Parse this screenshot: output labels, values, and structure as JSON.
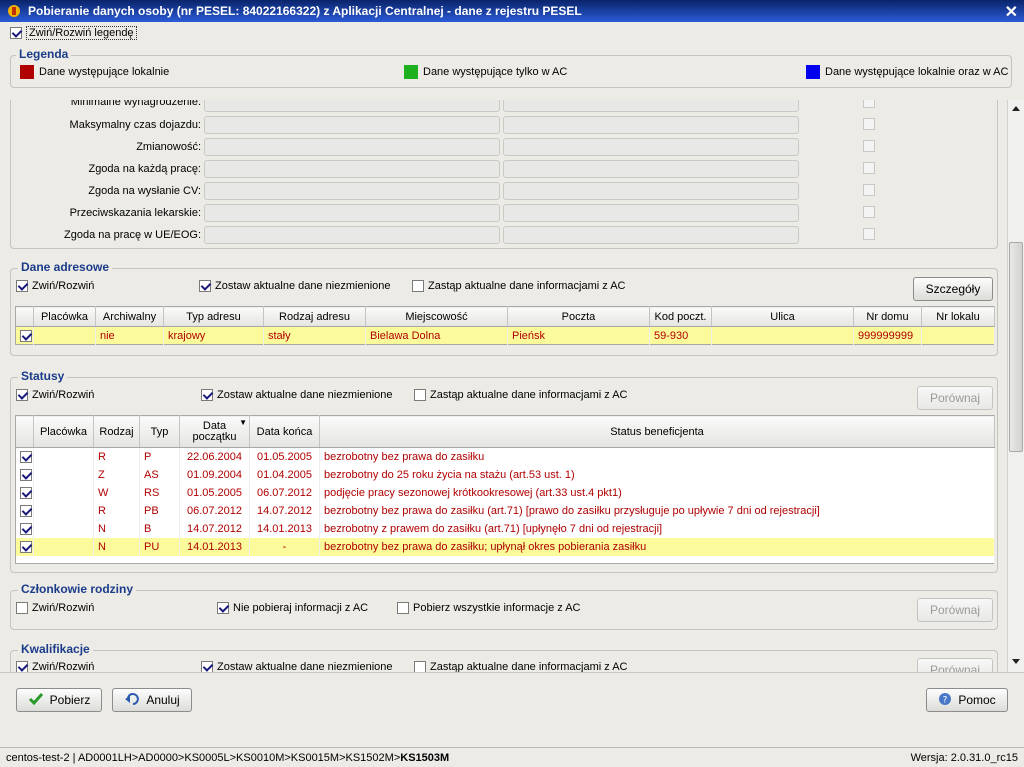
{
  "window": {
    "title": "Pobieranie danych osoby (nr PESEL: 84022166322) z Aplikacji Centralnej  - dane z rejestru PESEL",
    "close_glyph": "✕"
  },
  "legend_toggle": {
    "label": "Zwiń/Rozwiń legendę",
    "checked": true
  },
  "legend": {
    "title": "Legenda",
    "items": [
      {
        "label": "Dane występujące lokalnie",
        "color": "#b00000"
      },
      {
        "label": "Dane występujące tylko w AC",
        "color": "#1fb01f"
      },
      {
        "label": "Dane występujące lokalnie oraz w AC",
        "color": "#0000ee"
      }
    ]
  },
  "fields": [
    "Minimalne wynagrodzenie:",
    "Maksymalny czas dojazdu:",
    "Zmianowość:",
    "Zgoda na każdą pracę:",
    "Zgoda na wysłanie CV:",
    "Przeciwskazania lekarskie:",
    "Zgoda na pracę w UE/EOG:"
  ],
  "addresses": {
    "title": "Dane adresowe",
    "toggle": "Zwiń/Rozwiń",
    "keep": "Zostaw aktualne dane niezmienione",
    "replace": "Zastąp aktualne dane informacjami z AC",
    "details_button": "Szczegóły",
    "columns": [
      "Placówka",
      "Archiwalny",
      "Typ adresu",
      "Rodzaj adresu",
      "Miejscowość",
      "Poczta",
      "Kod poczt.",
      "Ulica",
      "Nr domu",
      "Nr lokalu"
    ],
    "rows": [
      [
        "",
        "nie",
        "krajowy",
        "stały",
        "Bielawa Dolna",
        "Pieńsk",
        "59-930",
        "",
        "999999999",
        ""
      ]
    ]
  },
  "statuses": {
    "title": "Statusy",
    "toggle": "Zwiń/Rozwiń",
    "keep": "Zostaw aktualne dane niezmienione",
    "replace": "Zastąp aktualne dane informacjami z AC",
    "compare_button": "Porównaj",
    "columns": [
      "Placówka",
      "Rodzaj",
      "Typ",
      "Data początku",
      "Data końca",
      "Status beneficjenta"
    ],
    "sort_glyph": "▼",
    "rows": [
      [
        "",
        "R",
        "P",
        "22.06.2004",
        "01.05.2005",
        "bezrobotny bez prawa do zasiłku"
      ],
      [
        "",
        "Z",
        "AS",
        "01.09.2004",
        "01.04.2005",
        "bezrobotny do 25 roku życia na stażu (art.53 ust. 1)"
      ],
      [
        "",
        "W",
        "RS",
        "01.05.2005",
        "06.07.2012",
        "podjęcie pracy sezonowej krótkookresowej (art.33 ust.4 pkt1)"
      ],
      [
        "",
        "R",
        "PB",
        "06.07.2012",
        "14.07.2012",
        "bezrobotny bez prawa do zasiłku (art.71) [prawo do zasiłku przysługuje po upływie 7 dni od rejestracji]"
      ],
      [
        "",
        "N",
        "B",
        "14.07.2012",
        "14.01.2013",
        "bezrobotny z prawem do zasiłku (art.71) [upłynęło 7 dni od rejestracji]"
      ],
      [
        "",
        "N",
        "PU",
        "14.01.2013",
        "-",
        "bezrobotny bez prawa do zasiłku; upłynął okres pobierania zasiłku"
      ]
    ]
  },
  "family": {
    "title": "Członkowie rodziny",
    "toggle": "Zwiń/Rozwiń",
    "no_fetch": "Nie pobieraj informacji z AC",
    "fetch_all": "Pobierz wszystkie informacje z AC",
    "compare_button": "Porównaj"
  },
  "qualifications": {
    "title": "Kwalifikacje",
    "toggle": "Zwiń/Rozwiń",
    "keep": "Zostaw aktualne dane niezmienione",
    "replace": "Zastąp aktualne dane informacjami z AC",
    "compare_button": "Porównaj"
  },
  "buttons": {
    "fetch": "Pobierz",
    "cancel": "Anuluj",
    "help": "Pomoc"
  },
  "statusbar": {
    "path": "centos-test-2 | AD0001LH>AD0000>KS0005L>KS0010M>KS0015M>KS1502M>",
    "current": "KS1503M",
    "version": "Wersja: 2.0.31.0_rc15"
  }
}
